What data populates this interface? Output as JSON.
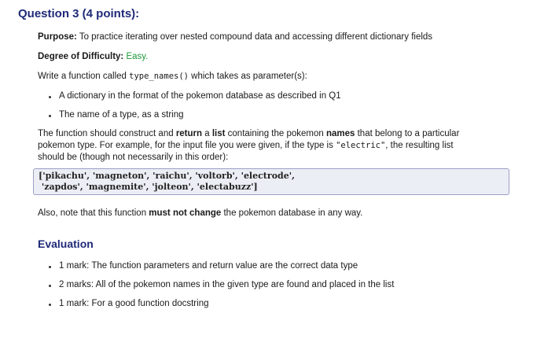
{
  "question": {
    "title": "Question 3 (4 points):"
  },
  "purpose": {
    "label": "Purpose:",
    "text": "To practice iterating over nested compound data and accessing different dictionary fields"
  },
  "difficulty": {
    "label": "Degree of Difficulty:",
    "value": "Easy."
  },
  "function_intro": {
    "before": "Write a function called ",
    "name": "type_names()",
    "after": " which takes as parameter(s):"
  },
  "params": [
    "A dictionary in the format of the pokemon database as described in Q1",
    "The name of a type, as a string"
  ],
  "description": {
    "p1": "The function should construct and ",
    "b1": "return",
    "p2": " a ",
    "b2": "list",
    "p3": " containing the pokemon ",
    "b3": "names",
    "p4": " that belong to a particular",
    "line2_pre": "pokemon type. For example, for the input file you were given, if the type is ",
    "line2_code": "\"electric\"",
    "line2_post": ", the resulting list",
    "line3": "should be (though not necessarily in this order):"
  },
  "code_output": {
    "line1": "['pikachu', 'magneton', 'raichu', 'voltorb', 'electrode',",
    "line2": " 'zapdos', 'magnemite', 'jolteon', 'electabuzz']"
  },
  "note": {
    "before": "Also, note that this function ",
    "bold": "must not change",
    "after": " the pokemon database in any way."
  },
  "evaluation": {
    "title": "Evaluation",
    "items": [
      "1 mark: The function parameters and return value are the correct data type",
      "2 marks: All of the pokemon names in the given type are found and placed in the list",
      "1 mark: For a good function docstring"
    ]
  },
  "colors": {
    "heading": "#1f2a78",
    "easy": "#1e9b3a",
    "code_bg": "#eceef5",
    "code_border": "#9b9fc4"
  }
}
